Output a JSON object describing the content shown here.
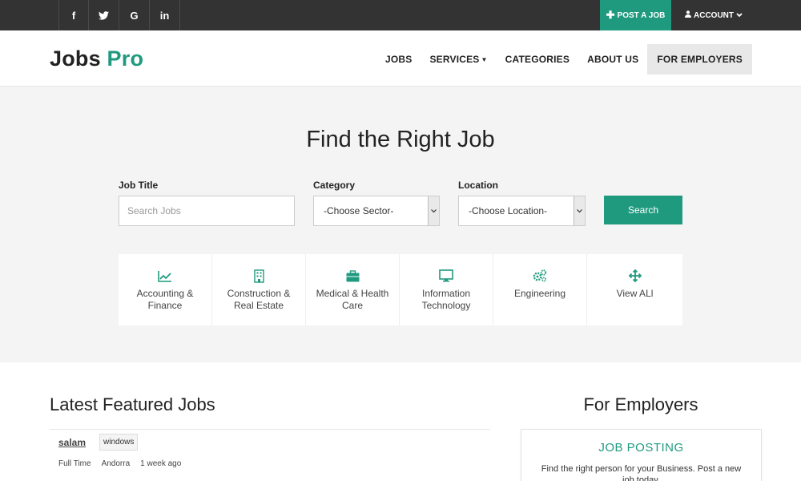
{
  "colors": {
    "accent": "#1f9a7f",
    "topbar": "#333333",
    "hero_bg": "#f4f4f4"
  },
  "topbar": {
    "social": [
      {
        "icon": "facebook-icon",
        "glyph": "f"
      },
      {
        "icon": "twitter-icon",
        "glyph": "t"
      },
      {
        "icon": "google-icon",
        "glyph": "G"
      },
      {
        "icon": "linkedin-icon",
        "glyph": "in"
      }
    ],
    "post_job": "POST A JOB",
    "account": "ACCOUNT"
  },
  "header": {
    "logo_main": "Jobs",
    "logo_accent": "Pro",
    "nav": {
      "jobs": "JOBS",
      "services": "SERVICES",
      "categories": "CATEGORIES",
      "about": "ABOUT US",
      "employers": "FOR EMPLOYERS"
    }
  },
  "hero": {
    "title": "Find the Right Job",
    "job_title_label": "Job Title",
    "job_title_placeholder": "Search Jobs",
    "category_label": "Category",
    "category_selected": "-Choose Sector-",
    "location_label": "Location",
    "location_selected": "-Choose Location-",
    "search_button": "Search"
  },
  "categories": [
    {
      "name": "Accounting & Finance",
      "icon": "chart-line-icon"
    },
    {
      "name": "Construction & Real Estate",
      "icon": "building-icon"
    },
    {
      "name": "Medical & Health Care",
      "icon": "briefcase-icon"
    },
    {
      "name": "Information Technology",
      "icon": "monitor-icon"
    },
    {
      "name": "Engineering",
      "icon": "gears-icon"
    },
    {
      "name": "View ALl",
      "icon": "move-arrows-icon"
    }
  ],
  "latest": {
    "title": "Latest Featured Jobs",
    "jobs": [
      {
        "title": "salam",
        "tag": "windows",
        "type": "Full Time",
        "location": "Andorra",
        "posted": "1 week ago"
      }
    ]
  },
  "employers": {
    "title": "For Employers",
    "card_title": "JOB POSTING",
    "card_text": "Find the right person for your Business. Post a new job today."
  }
}
